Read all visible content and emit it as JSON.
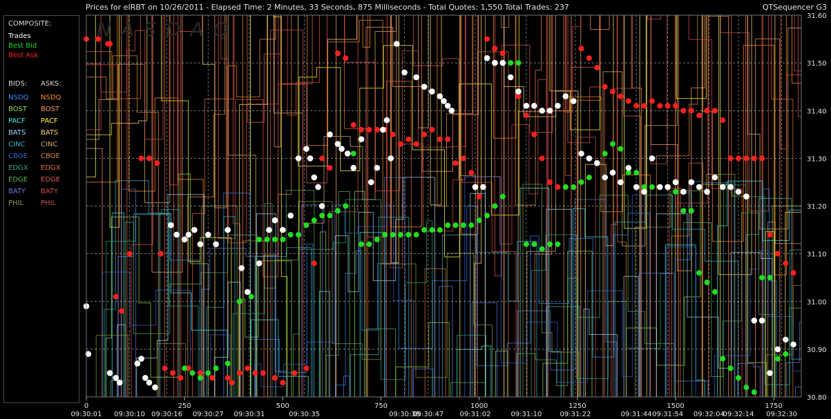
{
  "header": {
    "title": "Prices for  eIRBT  on  10/26/2011  -  Elapsed Time: 2 Minutes, 33 Seconds, 875 Milliseconds  -  Total Quotes: 1,550  Total Trades: 237",
    "app_name": "QTSequencer G3"
  },
  "legend": {
    "composite_label": "COMPOSITE:",
    "composite": [
      {
        "label": "Trades",
        "color": "#ffffff"
      },
      {
        "label": "Best Bid",
        "color": "#22dd22"
      },
      {
        "label": "Best Ask",
        "color": "#ff2020"
      }
    ],
    "bids_label": "BIDS:",
    "asks_label": "ASKS:",
    "exchanges": [
      {
        "bid": "NSDQ",
        "bid_color": "#3a8cff",
        "ask": "NSDQ",
        "ask_color": "#ff8c2a"
      },
      {
        "bid": "BOST",
        "bid_color": "#9adf58",
        "ask": "BOST",
        "ask_color": "#ff9c6a"
      },
      {
        "bid": "PACF",
        "bid_color": "#4af0f0",
        "ask": "PACF",
        "ask_color": "#ffff3a"
      },
      {
        "bid": "BATS",
        "bid_color": "#aad8ff",
        "ask": "BATS",
        "ask_color": "#ffd76a"
      },
      {
        "bid": "CINC",
        "bid_color": "#40b8c8",
        "ask": "CINC",
        "ask_color": "#d8b070"
      },
      {
        "bid": "CBOE",
        "bid_color": "#3c64d8",
        "ask": "CBOE",
        "ask_color": "#e08a40"
      },
      {
        "bid": "EDGX",
        "bid_color": "#3ca878",
        "ask": "EDGX",
        "ask_color": "#e06a3a"
      },
      {
        "bid": "EDGE",
        "bid_color": "#5ab85a",
        "ask": "EDGE",
        "ask_color": "#e05858"
      },
      {
        "bid": "BATY",
        "bid_color": "#6a7ce0",
        "ask": "BATY",
        "ask_color": "#e04a4a"
      },
      {
        "bid": "PHIL",
        "bid_color": "#8aa040",
        "ask": "PHIL",
        "ask_color": "#c85050"
      }
    ]
  },
  "chart_data": {
    "type": "scatter",
    "title": "",
    "xlabel": "",
    "ylabel": "",
    "xlim": [
      0,
      1820
    ],
    "ylim": [
      30.8,
      31.6
    ],
    "y_ticks": [
      "31.60",
      "31.50",
      "31.40",
      "31.30",
      "31.20",
      "31.10",
      "31.00",
      "30.90",
      "30.80"
    ],
    "x_tick_values": [
      0,
      250,
      500,
      750,
      1000,
      1250,
      1500,
      1750
    ],
    "time_labels": [
      "09:30:01",
      "09:30:10",
      "09:30:16",
      "09:30:27",
      "09:30:31",
      "09:30:35",
      "09:30:38",
      "09:30:47",
      "09:31:02",
      "09:31:10",
      "09:31:22",
      "09:31:44",
      "09:31:54",
      "09:32:04",
      "09:32:14",
      "09:32:30"
    ],
    "time_label_x": [
      0,
      110,
      205,
      310,
      415,
      555,
      810,
      870,
      990,
      1120,
      1245,
      1400,
      1480,
      1585,
      1660,
      1770
    ],
    "grid": true,
    "watermark": "NASDAQ",
    "series": [
      {
        "name": "Best Ask",
        "color": "#ff2020",
        "x": [
          0,
          30,
          55,
          60,
          75,
          90,
          110,
          140,
          160,
          180,
          190,
          200,
          220,
          240,
          260,
          290,
          320,
          360,
          370,
          390,
          410,
          430,
          450,
          480,
          500,
          530,
          560,
          580,
          600,
          620,
          640,
          660,
          680,
          700,
          720,
          740,
          760,
          780,
          800,
          820,
          840,
          860,
          880,
          900,
          920,
          940,
          960,
          980,
          1000,
          1020,
          1040,
          1060,
          1080,
          1100,
          1120,
          1140,
          1160,
          1180,
          1200,
          1220,
          1240,
          1260,
          1280,
          1300,
          1320,
          1340,
          1360,
          1380,
          1400,
          1420,
          1440,
          1460,
          1480,
          1500,
          1520,
          1540,
          1560,
          1580,
          1600,
          1620,
          1640,
          1660,
          1680,
          1700,
          1720,
          1740,
          1760,
          1780,
          1800
        ],
        "y": [
          31.55,
          31.55,
          31.54,
          31.54,
          31.01,
          30.98,
          31.1,
          31.3,
          31.3,
          31.29,
          31.1,
          30.86,
          30.85,
          30.84,
          30.86,
          30.85,
          30.84,
          30.84,
          30.83,
          30.85,
          30.86,
          30.85,
          30.85,
          30.84,
          30.83,
          30.85,
          30.86,
          31.08,
          31.3,
          31.28,
          31.52,
          31.51,
          31.37,
          31.36,
          31.36,
          31.36,
          31.36,
          31.35,
          31.33,
          31.34,
          31.33,
          31.35,
          31.36,
          31.34,
          31.34,
          31.29,
          31.3,
          31.27,
          31.22,
          31.55,
          31.53,
          31.52,
          31.47,
          31.43,
          31.39,
          31.35,
          31.3,
          31.25,
          31.24,
          31.24,
          31.24,
          31.53,
          31.51,
          31.49,
          31.45,
          31.44,
          31.43,
          31.42,
          31.41,
          31.41,
          31.42,
          31.41,
          31.41,
          31.41,
          31.4,
          31.4,
          31.39,
          31.4,
          31.4,
          31.38,
          31.3,
          31.3,
          31.3,
          31.3,
          31.3,
          31.14,
          31.1,
          31.08,
          31.06
        ]
      },
      {
        "name": "Best Bid",
        "color": "#22dd22",
        "x": [
          250,
          270,
          290,
          310,
          330,
          360,
          390,
          420,
          440,
          460,
          480,
          500,
          520,
          540,
          560,
          580,
          600,
          620,
          640,
          660,
          680,
          700,
          720,
          740,
          760,
          780,
          800,
          820,
          840,
          860,
          880,
          900,
          920,
          940,
          960,
          980,
          1000,
          1020,
          1040,
          1060,
          1080,
          1100,
          1120,
          1140,
          1160,
          1180,
          1200,
          1220,
          1240,
          1260,
          1280,
          1300,
          1320,
          1340,
          1360,
          1380,
          1400,
          1420,
          1440,
          1460,
          1480,
          1500,
          1520,
          1540,
          1560,
          1580,
          1600,
          1620,
          1640,
          1660,
          1680,
          1700,
          1720,
          1740,
          1760,
          1780,
          1800
        ],
        "y": [
          30.86,
          30.85,
          30.84,
          30.85,
          30.86,
          30.87,
          31.0,
          31.01,
          31.13,
          31.13,
          31.13,
          31.13,
          31.14,
          31.14,
          31.16,
          31.17,
          31.18,
          31.18,
          31.19,
          31.2,
          31.31,
          31.12,
          31.12,
          31.13,
          31.14,
          31.14,
          31.14,
          31.14,
          31.14,
          31.15,
          31.15,
          31.15,
          31.16,
          31.16,
          31.16,
          31.16,
          31.17,
          31.18,
          31.2,
          31.22,
          31.5,
          31.5,
          31.12,
          31.12,
          31.11,
          31.12,
          31.12,
          31.24,
          31.24,
          31.25,
          31.26,
          31.29,
          31.31,
          31.33,
          31.32,
          31.27,
          31.27,
          31.24,
          31.24,
          31.24,
          31.24,
          31.23,
          31.19,
          31.19,
          31.06,
          31.04,
          31.02,
          30.88,
          30.86,
          30.84,
          30.82,
          30.81,
          31.05,
          31.05,
          30.88,
          30.89,
          30.91
        ]
      },
      {
        "name": "Trades",
        "color": "#ffffff",
        "x": [
          0,
          5,
          60,
          75,
          85,
          130,
          140,
          150,
          160,
          175,
          215,
          230,
          250,
          260,
          275,
          290,
          310,
          330,
          360,
          395,
          410,
          440,
          465,
          480,
          500,
          520,
          540,
          560,
          570,
          580,
          590,
          600,
          620,
          640,
          650,
          665,
          680,
          700,
          725,
          740,
          755,
          765,
          775,
          790,
          810,
          840,
          860,
          880,
          900,
          910,
          920,
          930,
          990,
          1010,
          1020,
          1040,
          1060,
          1080,
          1100,
          1120,
          1140,
          1160,
          1180,
          1200,
          1220,
          1240,
          1260,
          1280,
          1300,
          1320,
          1340,
          1360,
          1380,
          1400,
          1420,
          1440,
          1460,
          1480,
          1500,
          1520,
          1540,
          1560,
          1580,
          1600,
          1620,
          1640,
          1660,
          1680,
          1700,
          1720,
          1740,
          1760,
          1780,
          1800
        ],
        "y": [
          30.99,
          30.89,
          30.85,
          30.84,
          30.83,
          30.87,
          30.88,
          30.84,
          30.83,
          30.82,
          31.16,
          31.14,
          31.13,
          31.14,
          31.15,
          31.12,
          31.14,
          31.12,
          31.15,
          31.07,
          31.02,
          31.08,
          31.15,
          31.17,
          31.15,
          31.18,
          31.3,
          31.32,
          31.3,
          31.26,
          31.24,
          31.2,
          31.35,
          31.33,
          31.32,
          31.31,
          31.28,
          31.34,
          31.25,
          31.28,
          31.36,
          31.38,
          31.3,
          31.54,
          31.48,
          31.47,
          31.45,
          31.44,
          31.43,
          31.42,
          31.41,
          31.4,
          31.24,
          31.24,
          31.51,
          31.5,
          31.5,
          31.47,
          31.44,
          31.41,
          31.41,
          31.4,
          31.4,
          31.41,
          31.43,
          31.42,
          31.31,
          31.3,
          31.29,
          31.26,
          31.27,
          31.25,
          31.28,
          31.24,
          31.23,
          31.3,
          31.24,
          31.24,
          31.25,
          31.23,
          31.25,
          31.24,
          31.23,
          31.26,
          31.24,
          31.24,
          31.23,
          31.22,
          30.96,
          30.96,
          30.85,
          30.9,
          30.92,
          30.91
        ]
      }
    ]
  }
}
